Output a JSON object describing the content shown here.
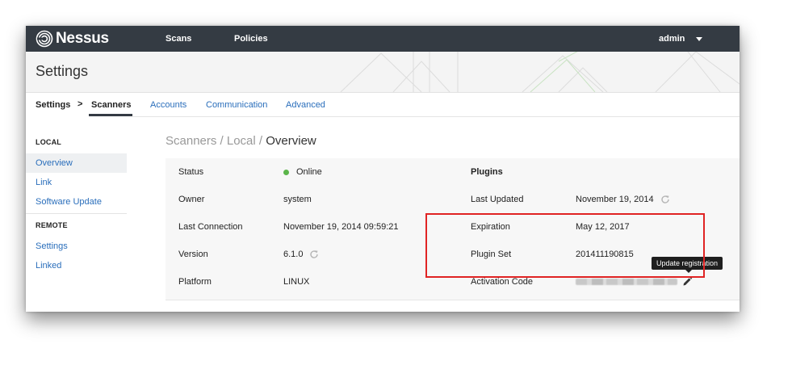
{
  "app": {
    "name": "Nessus"
  },
  "topnav": {
    "scans": "Scans",
    "policies": "Policies",
    "user": "admin"
  },
  "settings": {
    "title": "Settings"
  },
  "subnav": {
    "breadcrumb_root": "Settings",
    "separator": ">",
    "breadcrumb_active": "Scanners",
    "links": [
      "Accounts",
      "Communication",
      "Advanced"
    ]
  },
  "sidebar": {
    "local_header": "LOCAL",
    "local_items": [
      "Overview",
      "Link",
      "Software Update"
    ],
    "remote_header": "REMOTE",
    "remote_items": [
      "Settings",
      "Linked"
    ],
    "selected": "Overview"
  },
  "page": {
    "heading_prefix": "Scanners / Local / ",
    "heading_current": "Overview"
  },
  "scanner_info": {
    "status_label": "Status",
    "status_value": "Online",
    "owner_label": "Owner",
    "owner_value": "system",
    "last_connection_label": "Last Connection",
    "last_connection_value": "November 19, 2014 09:59:21",
    "version_label": "Version",
    "version_value": "6.1.0",
    "platform_label": "Platform",
    "platform_value": "LINUX"
  },
  "plugins": {
    "header": "Plugins",
    "last_updated_label": "Last Updated",
    "last_updated_value": "November 19, 2014",
    "expiration_label": "Expiration",
    "expiration_value": "May 12, 2017",
    "plugin_set_label": "Plugin Set",
    "plugin_set_value": "201411190815",
    "activation_code_label": "Activation Code"
  },
  "tooltip": {
    "text": "Update registration"
  },
  "colors": {
    "topbar": "#343b43",
    "link": "#2a6ebb",
    "status_online": "#5bb54a",
    "highlight_box": "#e02424"
  },
  "icons": [
    "nessus-logo-icon",
    "caret-down-icon",
    "refresh-icon",
    "pencil-icon"
  ]
}
